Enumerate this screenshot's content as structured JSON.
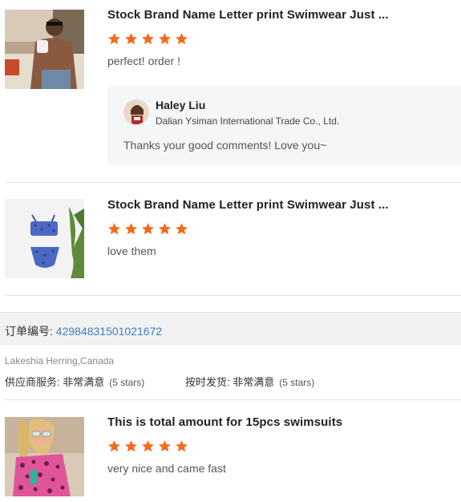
{
  "colors": {
    "star": "#f56a1f",
    "link": "#3a7fc4"
  },
  "reviews": [
    {
      "title": "Stock Brand Name Letter print Swimwear Just ...",
      "rating": 5,
      "comment": "perfect! order !"
    },
    {
      "title": "Stock Brand Name Letter print Swimwear Just ...",
      "rating": 5,
      "comment": "love them"
    },
    {
      "title": "This is total amount for 15pcs swimsuits",
      "rating": 5,
      "comment": "very nice and came fast"
    }
  ],
  "reply": {
    "name": "Haley Liu",
    "company": "Dalian Ysiman International Trade Co., Ltd.",
    "text": "Thanks your good comments! Love you~"
  },
  "order": {
    "label": "订单编号: ",
    "number": "42984831501021672"
  },
  "buyer": "Lakeshia Herring,Canada",
  "service_rating": {
    "label": "供应商服务: 非常满意",
    "note": "(5 stars)"
  },
  "delivery_rating": {
    "label": "按时发货: 非常满意",
    "note": "(5 stars)"
  }
}
